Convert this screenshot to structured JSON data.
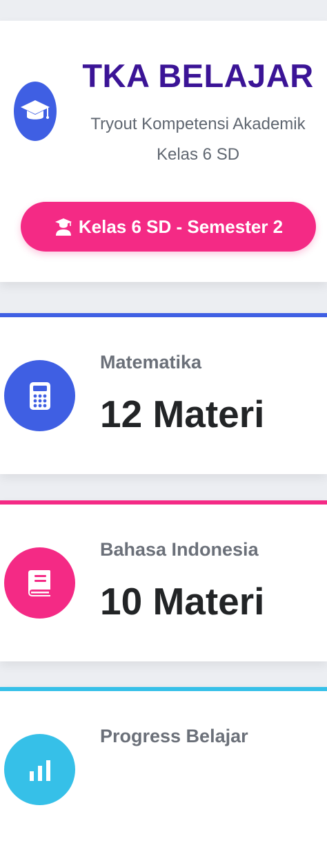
{
  "header": {
    "title": "TKA BELAJAR",
    "subtitle": "Tryout Kompetensi Akademik",
    "class_line": "Kelas 6 SD",
    "logo_icon": "graduation-cap-icon",
    "class_button": {
      "label": "Kelas 6 SD - Semester 2",
      "icon": "graduate-user-icon",
      "color": "#f42a85"
    },
    "title_color": "#3b1496"
  },
  "stats": [
    {
      "label": "Matematika",
      "value": "12 Materi",
      "icon": "calculator-icon",
      "color": "#3f5fe3"
    },
    {
      "label": "Bahasa Indonesia",
      "value": "10 Materi",
      "icon": "book-icon",
      "color": "#f42a85"
    },
    {
      "label": "Progress Belajar",
      "value": "",
      "icon": "progress-icon",
      "color": "#36c0e8"
    }
  ]
}
